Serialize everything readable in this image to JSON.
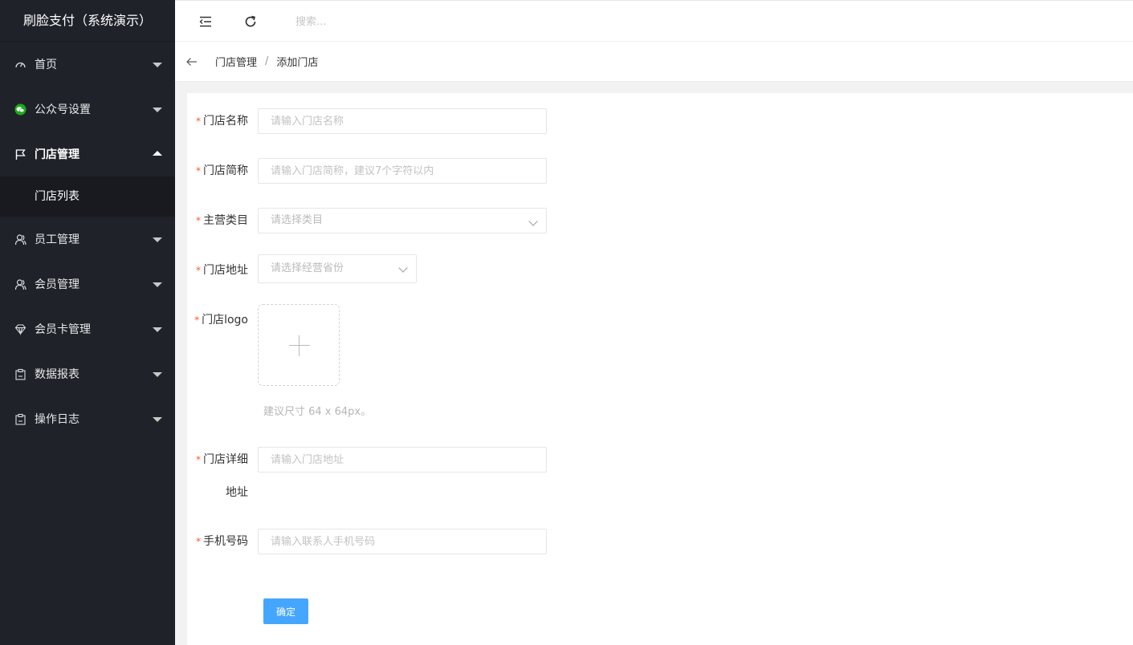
{
  "brand": "刷脸支付（系统演示）",
  "sidebar": {
    "items": [
      {
        "label": "首页",
        "icon": "dashboard-icon"
      },
      {
        "label": "公众号设置",
        "icon": "wechat-icon"
      },
      {
        "label": "门店管理",
        "icon": "flag-icon",
        "expanded": true,
        "children": [
          {
            "label": "门店列表"
          }
        ]
      },
      {
        "label": "员工管理",
        "icon": "user-icon"
      },
      {
        "label": "会员管理",
        "icon": "user-icon"
      },
      {
        "label": "会员卡管理",
        "icon": "diamond-icon"
      },
      {
        "label": "数据报表",
        "icon": "clipboard-icon"
      },
      {
        "label": "操作日志",
        "icon": "clipboard-icon"
      }
    ],
    "accent": "#1aad19"
  },
  "topbar": {
    "search_placeholder": "搜索..."
  },
  "breadcrumb": {
    "items": [
      "门店管理",
      "添加门店"
    ],
    "separator": "/"
  },
  "form": {
    "store_name": {
      "label": "门店名称",
      "placeholder": "请输入门店名称"
    },
    "store_short": {
      "label": "门店简称",
      "placeholder": "请输入门店简称，建议7个字符以内"
    },
    "category": {
      "label": "主营类目",
      "placeholder": "请选择类目"
    },
    "address": {
      "label": "门店地址",
      "placeholder": "请选择经营省份"
    },
    "logo": {
      "label": "门店logo",
      "hint": "建议尺寸 64 x 64px。"
    },
    "detail_address": {
      "label_line1": "门店详细",
      "label_line2": "地址",
      "placeholder": "请输入门店地址"
    },
    "phone": {
      "label": "手机号码",
      "placeholder": "请输入联系人手机号码"
    },
    "required_mark": "*",
    "submit_label": "确定"
  },
  "colors": {
    "sidebar_bg": "#20222a",
    "primary_button": "#45a6ff",
    "required": "#ff5722"
  }
}
